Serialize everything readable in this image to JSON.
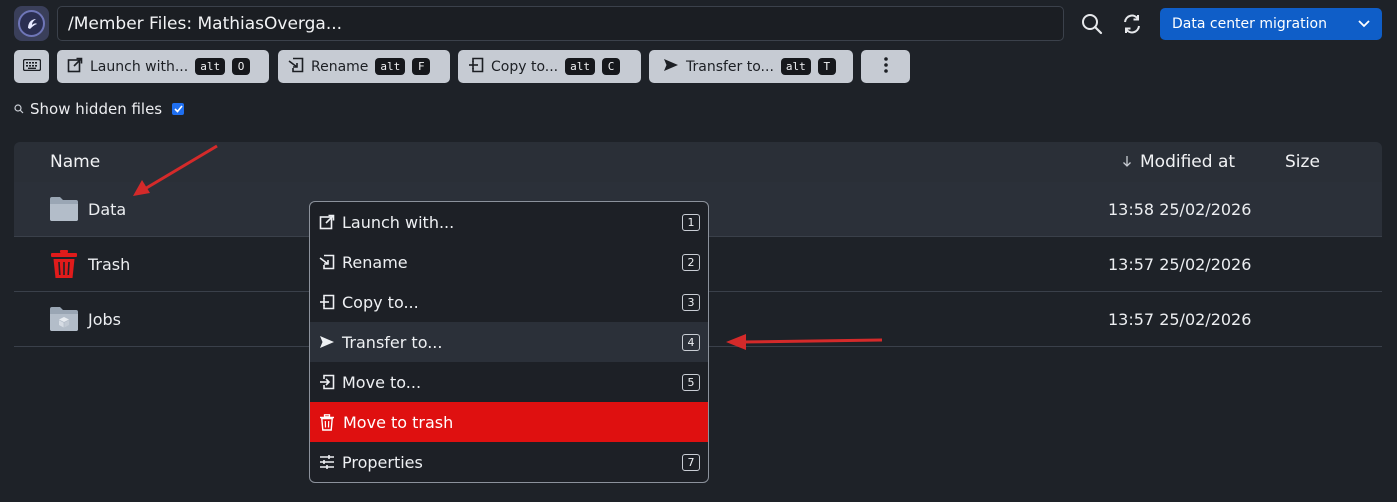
{
  "header": {
    "path": "/Member Files: MathiasOverga...",
    "project": "Data center migration",
    "logo_icon": "app-logo-icon",
    "search_icon": "search-icon",
    "refresh_icon": "refresh-icon"
  },
  "toolbar": {
    "keyboard_icon": "keyboard-icon",
    "buttons": [
      {
        "label": "Launch with...",
        "mod": "alt",
        "key": "O",
        "icon": "launch-icon"
      },
      {
        "label": "Rename",
        "mod": "alt",
        "key": "F",
        "icon": "rename-icon"
      },
      {
        "label": "Copy to...",
        "mod": "alt",
        "key": "C",
        "icon": "copy-icon"
      },
      {
        "label": "Transfer to...",
        "mod": "alt",
        "key": "T",
        "icon": "transfer-icon"
      }
    ],
    "more_icon": "more-vertical-icon"
  },
  "filters": {
    "show_hidden_label": "Show hidden files",
    "show_hidden_checked": true
  },
  "table": {
    "columns": {
      "name": "Name",
      "sort_icon": "arrow-down-icon",
      "modified": "Modified at",
      "size": "Size"
    },
    "rows": [
      {
        "name": "Data",
        "modified": "13:58 25/02/2026",
        "icon": "folder-icon",
        "selected": true
      },
      {
        "name": "Trash",
        "modified": "13:57 25/02/2026",
        "icon": "trash-icon",
        "selected": false
      },
      {
        "name": "Jobs",
        "modified": "13:57 25/02/2026",
        "icon": "jobs-folder-icon",
        "selected": false
      }
    ]
  },
  "context_menu": {
    "items": [
      {
        "label": "Launch with...",
        "shortcut": "1",
        "icon": "launch-icon"
      },
      {
        "label": "Rename",
        "shortcut": "2",
        "icon": "rename-icon"
      },
      {
        "label": "Copy to...",
        "shortcut": "3",
        "icon": "copy-icon"
      },
      {
        "label": "Transfer to...",
        "shortcut": "4",
        "icon": "transfer-icon",
        "highlighted": true
      },
      {
        "label": "Move to...",
        "shortcut": "5",
        "icon": "move-icon"
      },
      {
        "label": "Move to trash",
        "shortcut": "",
        "icon": "trash-icon",
        "danger": true
      },
      {
        "label": "Properties",
        "shortcut": "7",
        "icon": "properties-icon"
      }
    ]
  },
  "colors": {
    "background": "#1e2228",
    "accent": "#0f5ec8",
    "danger": "#df1010",
    "annotation_arrow": "#d42a2a"
  }
}
